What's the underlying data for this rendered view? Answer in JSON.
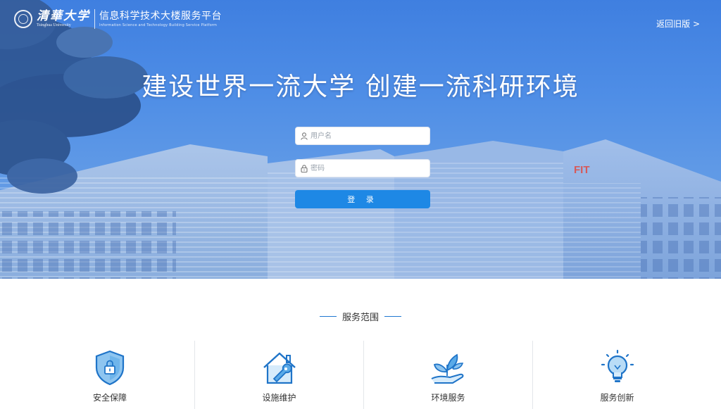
{
  "brand": {
    "university_cn": "清華大学",
    "university_en": "Tsinghua University",
    "platform_cn": "信息科学技术大楼服务平台",
    "platform_en": "Information Science and Technology Building Service Platform"
  },
  "header": {
    "old_version_link": "返回旧版 >"
  },
  "hero": {
    "slogan": "建设世界一流大学  创建一流科研环境",
    "building_sign": "FIT"
  },
  "login": {
    "username_placeholder": "用户名",
    "password_placeholder": "密码",
    "submit_label": "登 录",
    "accent_color": "#1e88e5"
  },
  "services": {
    "title": "服务范围",
    "items": [
      {
        "label": "安全保障",
        "icon": "shield-lock-icon"
      },
      {
        "label": "设施维护",
        "icon": "house-wrench-icon"
      },
      {
        "label": "环境服务",
        "icon": "hand-plant-icon"
      },
      {
        "label": "服务创新",
        "icon": "lightbulb-icon"
      }
    ]
  }
}
